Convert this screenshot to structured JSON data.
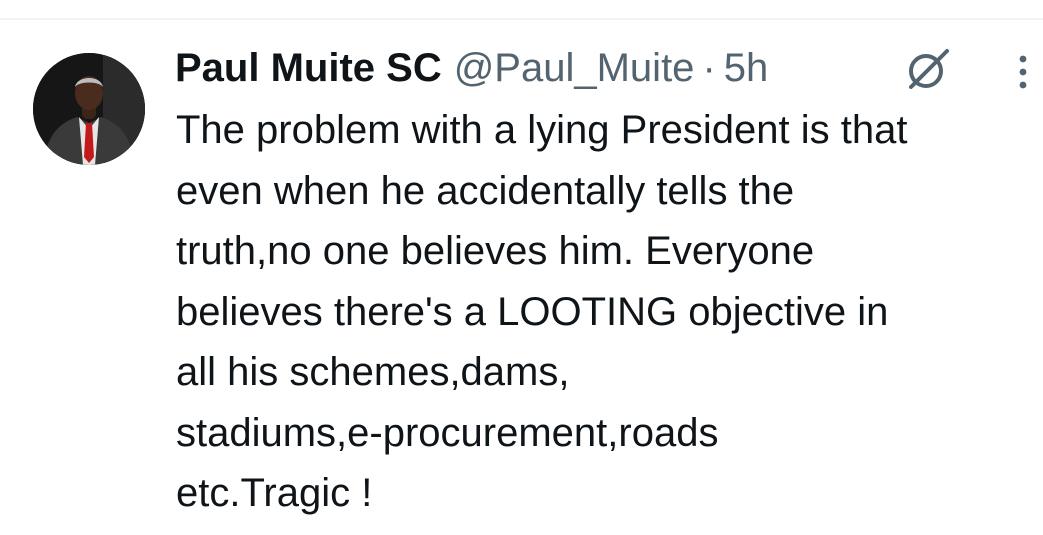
{
  "tweet": {
    "author": {
      "display_name": "Paul Muite SC",
      "handle": "@Paul_Muite",
      "avatar_icon": "profile-photo"
    },
    "separator": "·",
    "timestamp": "5h",
    "actions": {
      "grok_icon": "grok-icon",
      "more_icon": "more-options-icon"
    },
    "text_lines": [
      "The problem with a lying President is that",
      "even when he accidentally tells the",
      "truth,no one believes him. Everyone",
      "believes there's a LOOTING objective in",
      "all his schemes,dams,",
      "stadiums,e-procurement,roads",
      "etc.Tragic !"
    ]
  },
  "colors": {
    "text_primary": "#0f1419",
    "text_secondary": "#536471",
    "divider": "#eff3f4",
    "background": "#ffffff"
  }
}
